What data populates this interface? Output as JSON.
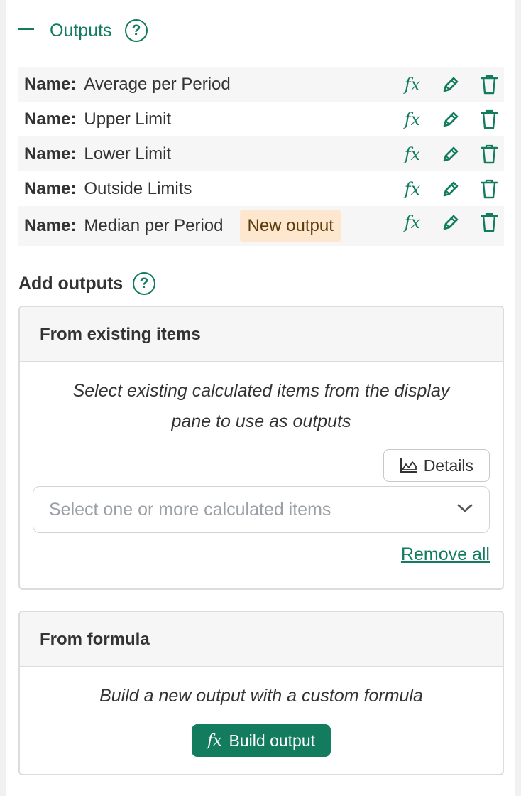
{
  "outputs": {
    "title": "Outputs",
    "help_icon": "?",
    "name_label": "Name:",
    "fx_icon": "fx",
    "rows": [
      {
        "name": "Average per Period"
      },
      {
        "name": "Upper Limit"
      },
      {
        "name": "Lower Limit"
      },
      {
        "name": "Outside Limits"
      },
      {
        "name": "Median per Period",
        "badge": "New output"
      }
    ]
  },
  "add_outputs": {
    "title": "Add outputs",
    "help_icon": "?",
    "from_existing": {
      "header": "From existing items",
      "hint_line1": "Select existing calculated items from the display",
      "hint_line2": "pane to use as outputs",
      "details_label": "Details",
      "select_placeholder": "Select one or more calculated items",
      "remove_all_label": "Remove all"
    },
    "from_formula": {
      "header": "From formula",
      "hint": "Build a new output with a custom formula",
      "build_fx": "fx",
      "build_label": "Build output"
    }
  },
  "colors": {
    "accent": "#137c5f",
    "badge_bg": "#fde8cf",
    "row_shade": "#f6f6f6"
  },
  "icons": [
    "minus-icon",
    "help-icon",
    "fx-icon",
    "pencil-icon",
    "trash-icon",
    "chart-icon",
    "chevron-down-icon"
  ]
}
